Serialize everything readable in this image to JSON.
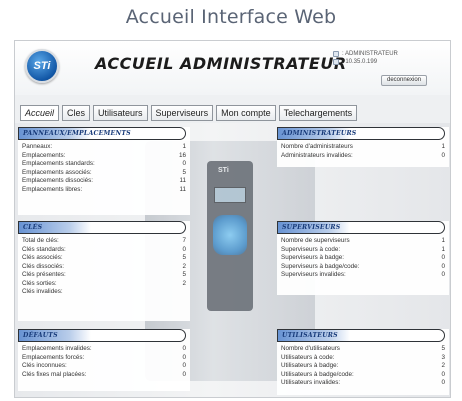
{
  "page_title": "Accueil Interface Web",
  "header": {
    "logo_text": "STi",
    "title": "ACCUEIL ADMINISTRATEUR",
    "user": ": ADMINISTRATEUR",
    "ip": ": 10.35.0.199",
    "logout_label": "deconnexion"
  },
  "tabs": [
    {
      "label": "Accueil"
    },
    {
      "label": "Cles"
    },
    {
      "label": "Utilisateurs"
    },
    {
      "label": "Superviseurs"
    },
    {
      "label": "Mon compte"
    },
    {
      "label": "Telechargements"
    }
  ],
  "device": {
    "logo_text": "STi"
  },
  "panels": {
    "panneaux": {
      "title": "PANNEAUX/EMPLACEMENTS",
      "rows": [
        {
          "label": "Panneaux:",
          "value": "1"
        },
        {
          "label": "Emplacements:",
          "value": "16"
        },
        {
          "label": "Emplacements standards:",
          "value": "0"
        },
        {
          "label": "Emplacements associés:",
          "value": "5"
        },
        {
          "label": "Emplacements dissociés:",
          "value": "11"
        },
        {
          "label": "Emplacements libres:",
          "value": "11"
        }
      ]
    },
    "cles": {
      "title": "CLÉS",
      "rows": [
        {
          "label": "Total de clés:",
          "value": "7"
        },
        {
          "label": "Clés standards:",
          "value": "0"
        },
        {
          "label": "Clés associés:",
          "value": "5"
        },
        {
          "label": "Clés dissociés:",
          "value": "2"
        },
        {
          "label": "Clés présentes:",
          "value": "5"
        },
        {
          "label": "Clés sorties:",
          "value": "2"
        },
        {
          "label": "Clés invalides:",
          "value": ""
        }
      ]
    },
    "defauts": {
      "title": "DÉFAUTS",
      "rows": [
        {
          "label": "Emplacements invalides:",
          "value": "0"
        },
        {
          "label": "Emplacements forcés:",
          "value": "0"
        },
        {
          "label": "Clés inconnues:",
          "value": "0"
        },
        {
          "label": "Clés fixes mal placées:",
          "value": "0"
        }
      ]
    },
    "admins": {
      "title": "ADMINISTRATEURS",
      "rows": [
        {
          "label": "Nombre d'administrateurs",
          "value": "1"
        },
        {
          "label": "Administrateurs invalides:",
          "value": "0"
        }
      ]
    },
    "supers": {
      "title": "SUPERVISEURS",
      "rows": [
        {
          "label": "Nombre de superviseurs",
          "value": "1"
        },
        {
          "label": "Superviseurs à code:",
          "value": "1"
        },
        {
          "label": "Superviseurs à badge:",
          "value": "0"
        },
        {
          "label": "Superviseurs à badge/code:",
          "value": "0"
        },
        {
          "label": "Superviseurs invalides:",
          "value": "0"
        }
      ]
    },
    "users": {
      "title": "UTILISATEURS",
      "rows": [
        {
          "label": "Nombre d'utilisateurs",
          "value": "5"
        },
        {
          "label": "Utilisateurs à code:",
          "value": "3"
        },
        {
          "label": "Utilisateurs à badge:",
          "value": "2"
        },
        {
          "label": "Utilisateurs à badge/code:",
          "value": "0"
        },
        {
          "label": "Utilisateurs invalides:",
          "value": "0"
        }
      ]
    }
  }
}
